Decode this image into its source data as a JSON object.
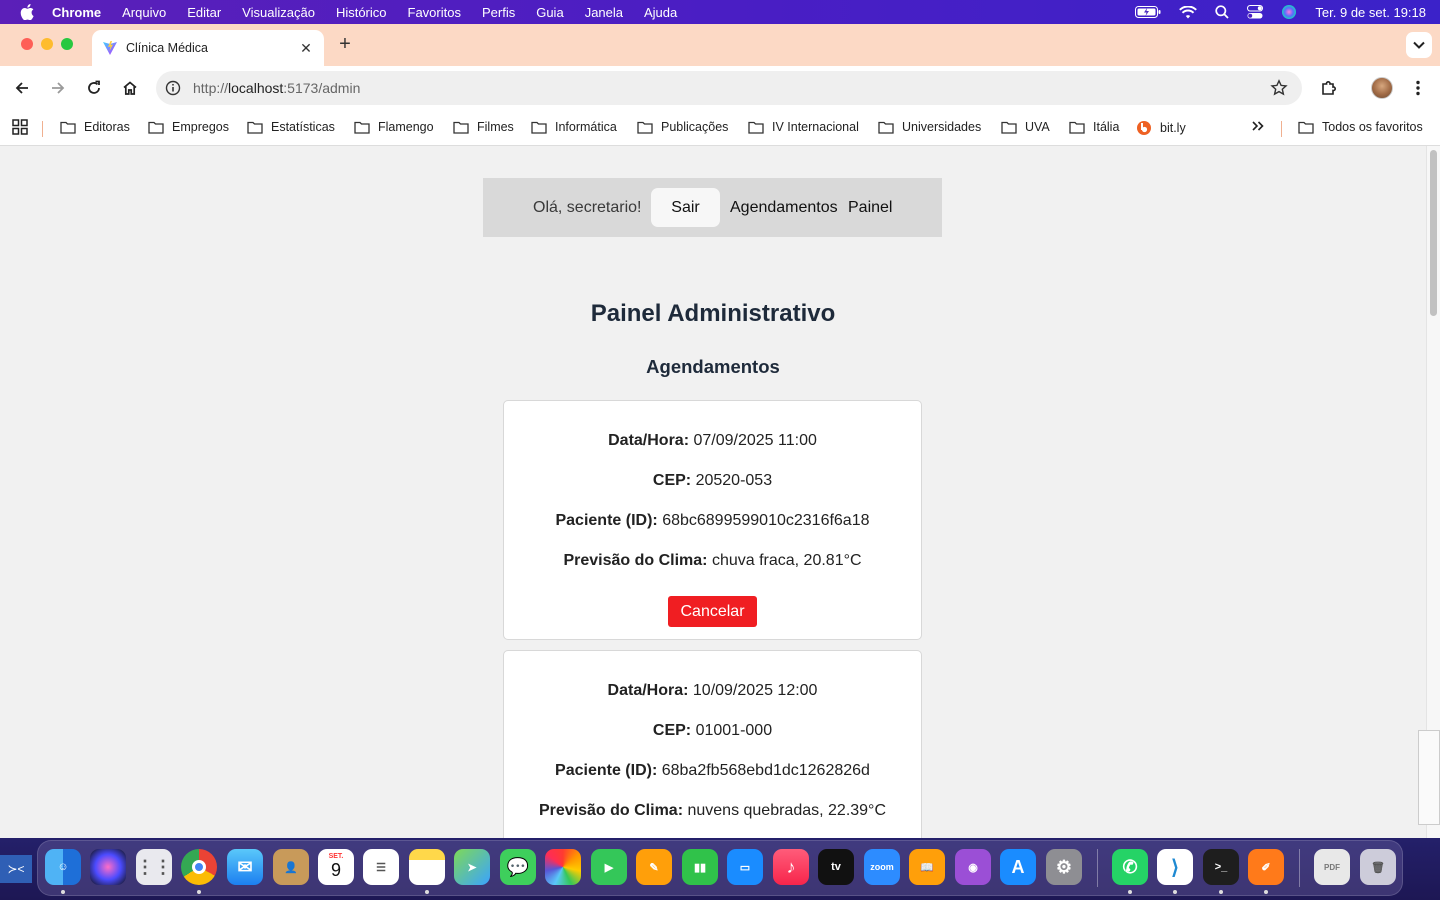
{
  "menubar": {
    "app": "Chrome",
    "items": [
      "Arquivo",
      "Editar",
      "Visualização",
      "Histórico",
      "Favoritos",
      "Perfis",
      "Guia",
      "Janela",
      "Ajuda"
    ],
    "clock": "Ter. 9 de set.  19:18"
  },
  "browser": {
    "tab_title": "Clínica Médica",
    "url_prefix": "http://",
    "url_host": "localhost",
    "url_rest": ":5173/admin",
    "bookmarks": [
      "Editoras",
      "Empregos",
      "Estatísticas",
      "Flamengo",
      "Filmes",
      "Informática",
      "Publicações",
      "IV Internacional",
      "Universidades",
      "UVA",
      "Itália",
      "bit.ly"
    ],
    "all_bookmarks": "Todos os favoritos"
  },
  "nav": {
    "greeting": "Olá, secretario!",
    "logout": "Sair",
    "link_appointments": "Agendamentos",
    "link_panel": "Painel"
  },
  "page": {
    "title": "Painel Administrativo",
    "subtitle": "Agendamentos"
  },
  "labels": {
    "datetime": "Data/Hora:",
    "cep": "CEP:",
    "patient": "Paciente (ID):",
    "weather": "Previsão do Clima:",
    "cancel": "Cancelar"
  },
  "appointments": [
    {
      "datetime": "07/09/2025 11:00",
      "cep": "20520-053",
      "patient_id": "68bc6899599010c2316f6a18",
      "weather": "chuva fraca, 20.81°C"
    },
    {
      "datetime": "10/09/2025 12:00",
      "cep": "01001-000",
      "patient_id": "68ba2fb568ebd1dc1262826d",
      "weather": "nuvens quebradas, 22.39°C"
    }
  ],
  "dock": {
    "calendar_month": "SET.",
    "calendar_day": "9",
    "zoom": "zoom"
  }
}
